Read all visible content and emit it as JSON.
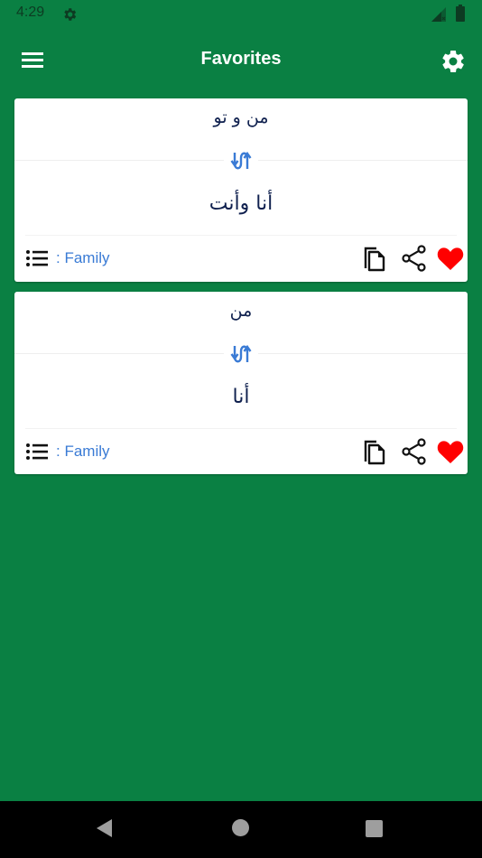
{
  "status_bar": {
    "time": "4:29",
    "icons": [
      "settings-gear-icon",
      "signal-no-service-icon",
      "battery-full-icon"
    ]
  },
  "app_bar": {
    "title": "Favorites",
    "left_icon": "hamburger-menu-icon",
    "right_icon": "settings-gear-icon"
  },
  "colors": {
    "background": "#0a8043",
    "text_dark": "#10214f",
    "accent_blue": "#3a7bd5",
    "favorite_red": "#ff0000"
  },
  "favorites": [
    {
      "source": "من و تو",
      "target": "أنا وأنت",
      "category_label": ": Family",
      "favorited": true
    },
    {
      "source": "من",
      "target": "أنا",
      "category_label": ": Family",
      "favorited": true
    }
  ],
  "nav_bar": {
    "buttons": [
      "back",
      "home",
      "recents"
    ]
  }
}
